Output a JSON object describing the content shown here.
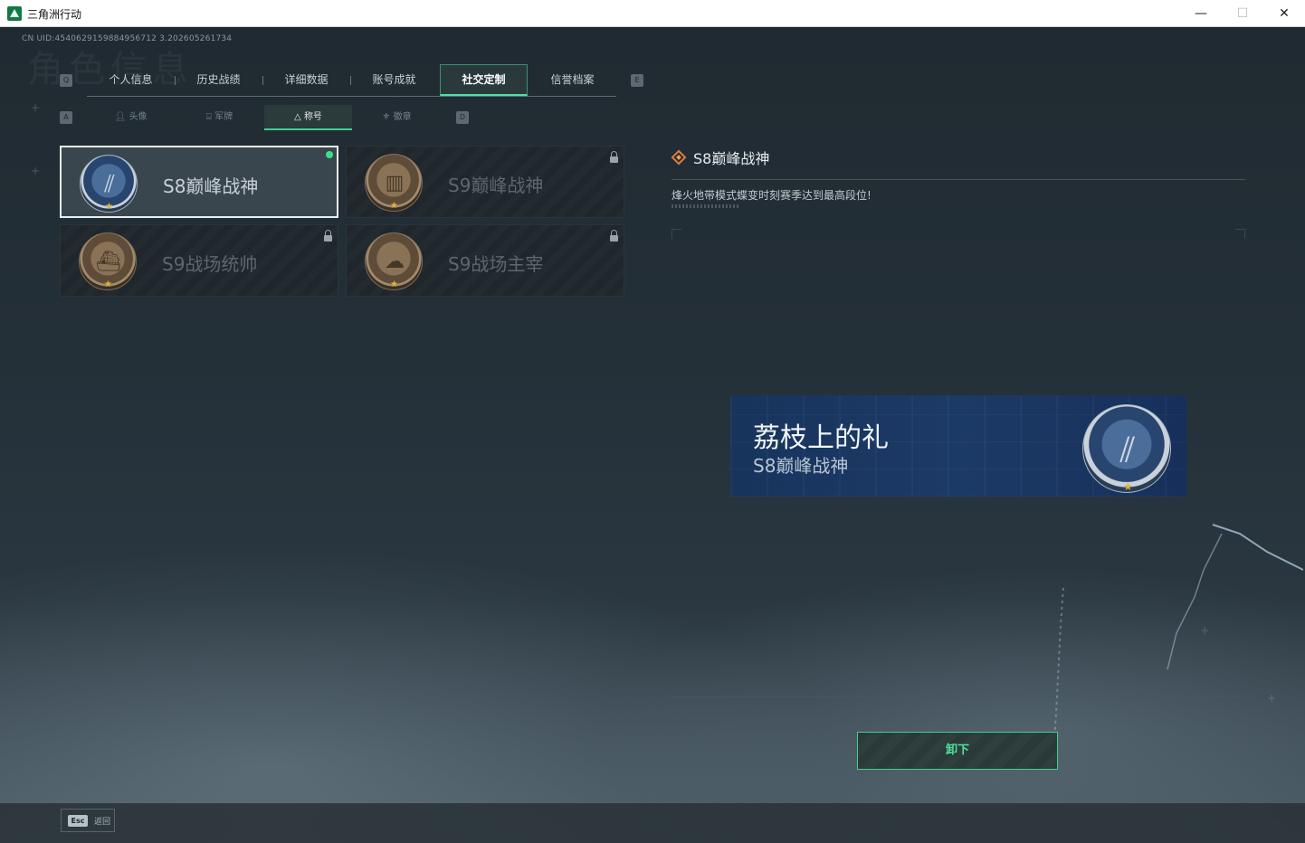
{
  "window": {
    "title": "三角洲行动",
    "min": "—",
    "max": "☐",
    "close": "✕"
  },
  "uid": "CN UID:4540629159884956712 3.202605261734",
  "ghost_title": "角色信息",
  "keys": {
    "tab_left": "Q",
    "tab_right": "E",
    "sub_left": "A",
    "sub_right": "D"
  },
  "tabs": [
    "个人信息",
    "历史战绩",
    "详细数据",
    "账号成就",
    "社交定制",
    "信誉档案"
  ],
  "active_tab": "社交定制",
  "subtabs": [
    "头像",
    "军牌",
    "称号",
    "徽章"
  ],
  "subtab_icons": [
    "person-icon",
    "dogtag-icon",
    "title-icon",
    "badge-icon"
  ],
  "active_subtab": "称号",
  "titles": [
    {
      "label": "S8巅峰战神",
      "selected": true,
      "locked": false,
      "equipped": true,
      "medal": "blue"
    },
    {
      "label": "S9巅峰战神",
      "selected": false,
      "locked": true,
      "equipped": false,
      "medal": "brown"
    },
    {
      "label": "S9战场统帅",
      "selected": false,
      "locked": true,
      "equipped": false,
      "medal": "brown"
    },
    {
      "label": "S9战场主宰",
      "selected": false,
      "locked": true,
      "equipped": false,
      "medal": "brown"
    }
  ],
  "detail": {
    "title": "S8巅峰战神",
    "description": "烽火地带模式蝶变时刻赛季达到最高段位!"
  },
  "banner": {
    "player_name": "荔枝上的礼",
    "title": "S8巅峰战神"
  },
  "unequip_button": "卸下",
  "footer": {
    "esc_key": "Esc",
    "esc_label": "返回"
  },
  "colors": {
    "accent": "#4fe3a0",
    "equipped_dot": "#38e08e",
    "diamond": "#e07a3a"
  }
}
